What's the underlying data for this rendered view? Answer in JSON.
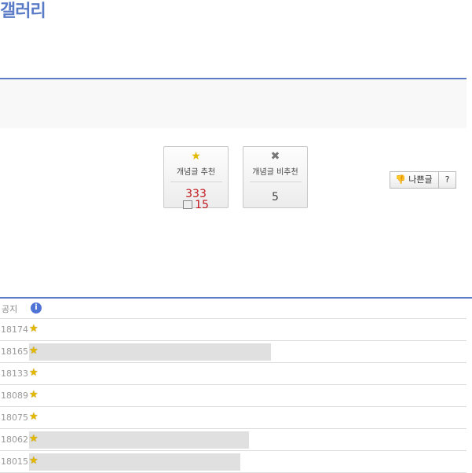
{
  "page": {
    "title": "갤러리"
  },
  "vote": {
    "up": {
      "label": "개념글 추천",
      "count": "333",
      "sub_count": "15",
      "icon": "star-icon"
    },
    "down": {
      "label": "개념글 비추천",
      "count": "5",
      "icon": "x-icon"
    }
  },
  "report": {
    "label": "나쁜글",
    "help": "?"
  },
  "list": {
    "notice_label": "공지",
    "rows": [
      {
        "num": "18174",
        "bar_fraction": 0
      },
      {
        "num": "18165",
        "bar_fraction": 0.55
      },
      {
        "num": "18133",
        "bar_fraction": 0
      },
      {
        "num": "18089",
        "bar_fraction": 0
      },
      {
        "num": "18075",
        "bar_fraction": 0
      },
      {
        "num": "18062",
        "bar_fraction": 0.5
      },
      {
        "num": "18015",
        "bar_fraction": 0.48
      }
    ]
  }
}
